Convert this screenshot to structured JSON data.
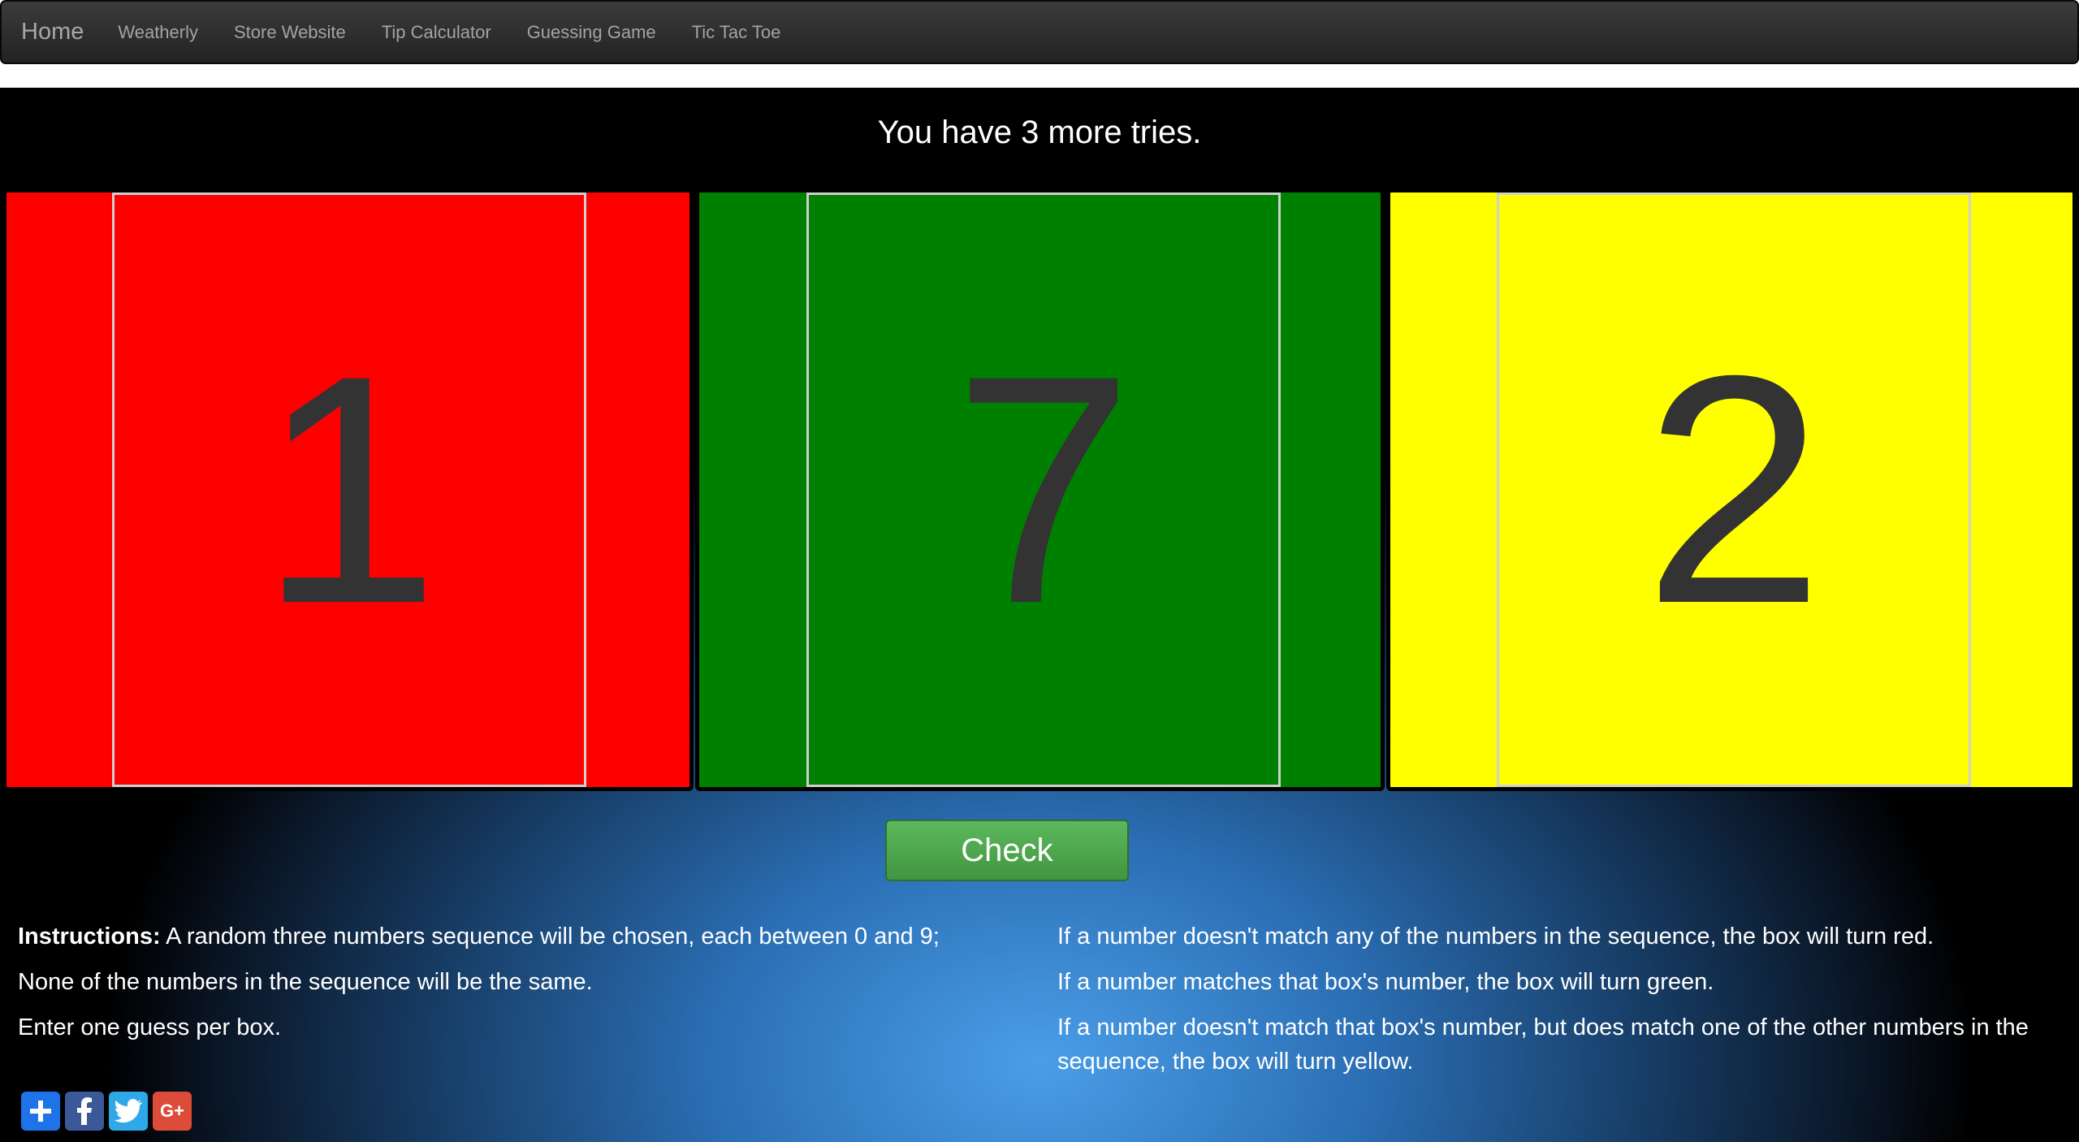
{
  "nav": {
    "brand": "Home",
    "links": [
      "Weatherly",
      "Store Website",
      "Tip Calculator",
      "Guessing Game",
      "Tic Tac Toe"
    ]
  },
  "game": {
    "tries_text": "You have 3 more tries.",
    "boxes": [
      {
        "value": "1",
        "color": "#ff0000"
      },
      {
        "value": "7",
        "color": "#008000"
      },
      {
        "value": "2",
        "color": "#ffff00"
      }
    ],
    "check_label": "Check"
  },
  "instructions": {
    "left": {
      "label": "Instructions:",
      "line1": " A random three numbers sequence will be chosen, each between 0 and 9;",
      "line2": "None of the numbers in the sequence will be the same.",
      "line3": "Enter one guess per box."
    },
    "right": {
      "line1": "If a number doesn't match any of the numbers in the sequence, the box will turn red.",
      "line2": "If a number matches that box's number, the box will turn green.",
      "line3": "If a number doesn't match that box's number, but does match one of the other numbers in the sequence, the box will turn yellow."
    }
  },
  "social": [
    {
      "icon": "addthis-plus-icon",
      "color": "#1e73e8"
    },
    {
      "icon": "facebook-icon",
      "color": "#3b5998"
    },
    {
      "icon": "twitter-icon",
      "color": "#2fa8e8"
    },
    {
      "icon": "google-plus-icon",
      "color": "#dd4b39",
      "text": "G+"
    }
  ]
}
